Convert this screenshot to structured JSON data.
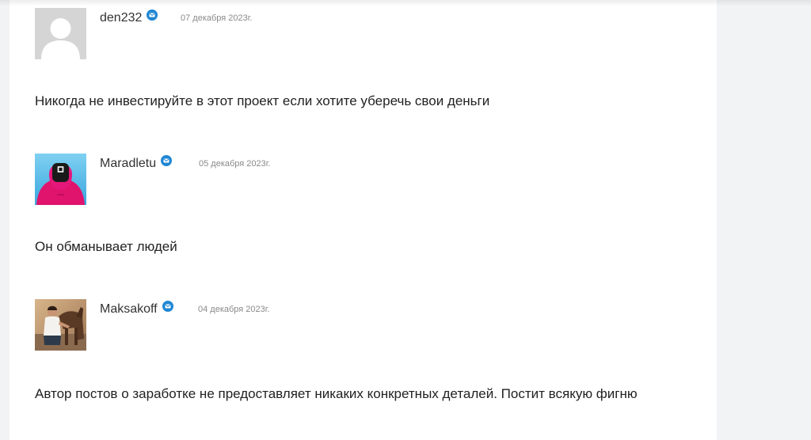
{
  "comments": [
    {
      "author": "den232",
      "date": "07 декабря 2023г.",
      "text": "Никогда не инвестируйте в этот проект если хотите уберечь свои деньги",
      "avatar": "default-user-avatar"
    },
    {
      "author": "Maradletu",
      "date": "05 декабря 2023г.",
      "text": "Он обманывает людей",
      "avatar": "pink-guard-avatar"
    },
    {
      "author": "Maksakoff",
      "date": "04 декабря 2023г.",
      "text": "Автор постов о заработке не предоставляет никаких конкретных деталей. Постит всякую фигню",
      "avatar": "horse-rider-avatar"
    }
  ],
  "colors": {
    "badge": "#1f86d3",
    "page_bg": "#f1f3f5",
    "card_bg": "#ffffff",
    "text": "#222222",
    "date": "#8a8a8a",
    "avatar_pink": "#e0136d",
    "avatar_sky": "#4bb6e8"
  }
}
